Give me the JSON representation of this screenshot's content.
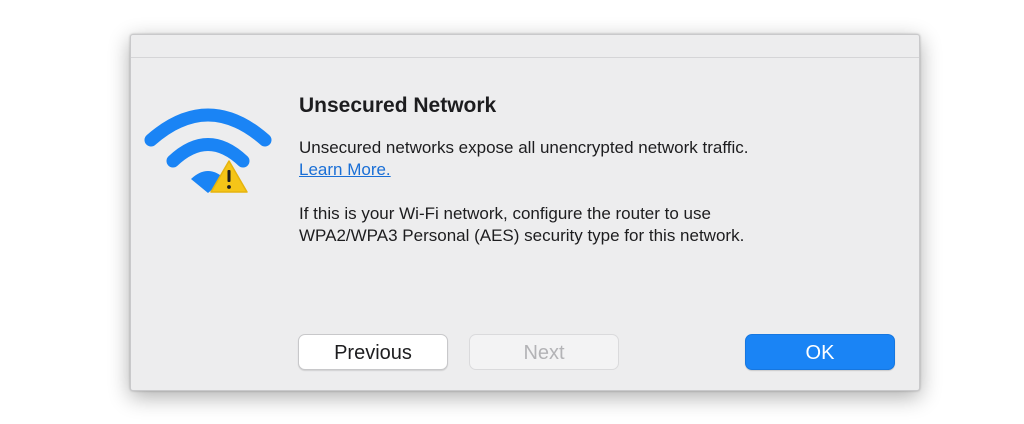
{
  "dialog": {
    "title": "Unsecured Network",
    "message_line1": "Unsecured networks expose all unencrypted network traffic.",
    "learn_more_link": "Learn More.",
    "message_line2a": "If this is your Wi-Fi network, configure the router to use",
    "message_line2b": "WPA2/WPA3 Personal (AES) security type for this network.",
    "icon": "wifi-warning-icon"
  },
  "buttons": {
    "previous_label": "Previous",
    "next_label": "Next",
    "ok_label": "OK"
  },
  "colors": {
    "wifi_blue": "#1a84f5",
    "warning_yellow": "#f5c518",
    "primary_button": "#1a84f5",
    "link": "#1a6fd6"
  }
}
